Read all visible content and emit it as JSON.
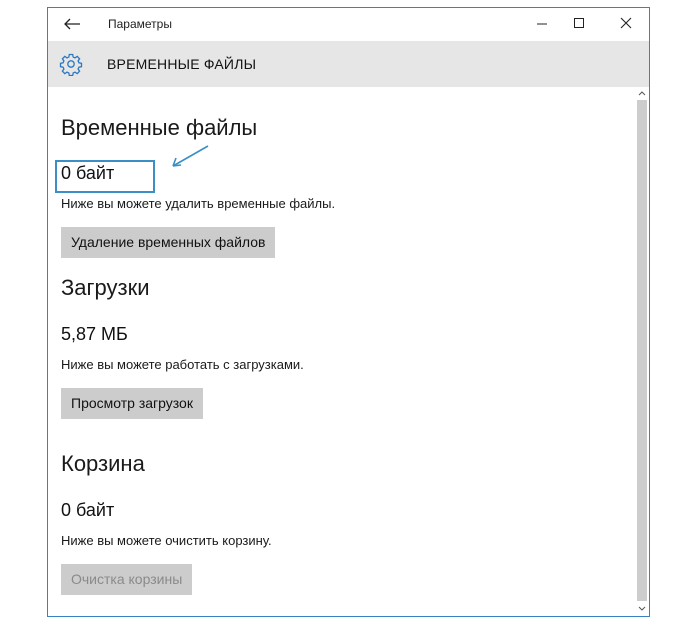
{
  "window": {
    "title": "Параметры"
  },
  "header": {
    "title": "ВРЕМЕННЫЕ ФАЙЛЫ"
  },
  "sections": [
    {
      "title": "Временные файлы",
      "size": "0 байт",
      "description": "Ниже вы можете удалить временные файлы.",
      "button": "Удаление временных файлов",
      "button_enabled": true
    },
    {
      "title": "Загрузки",
      "size": "5,87 МБ",
      "description": "Ниже вы можете работать с загрузками.",
      "button": "Просмотр загрузок",
      "button_enabled": true
    },
    {
      "title": "Корзина",
      "size": "0 байт",
      "description": "Ниже вы можете очистить корзину.",
      "button": "Очистка корзины",
      "button_enabled": false
    }
  ],
  "icons": {
    "back": "back-arrow-icon",
    "settings": "gear-icon",
    "minimize": "minimize-icon",
    "maximize": "maximize-icon",
    "close": "close-icon"
  },
  "colors": {
    "accent": "#3c8fc4",
    "header_bg": "#e6e6e6",
    "button_bg": "#cccccc"
  }
}
